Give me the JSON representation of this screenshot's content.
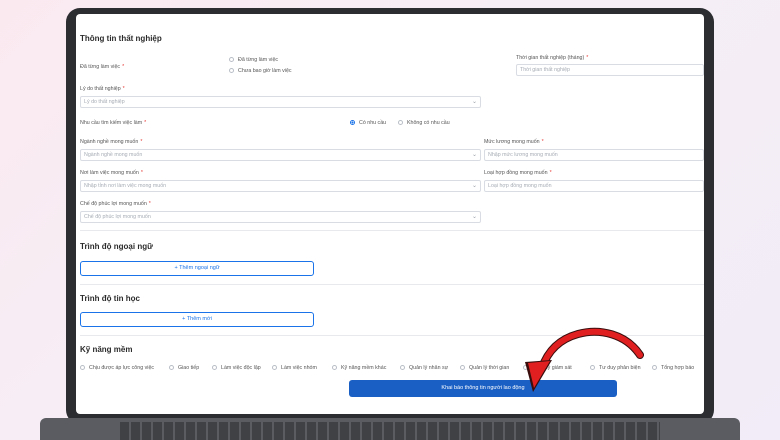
{
  "unemployment": {
    "title": "Thông tin thất nghiệp",
    "worked_label": "Đã từng làm việc",
    "worked_options": [
      "Đã từng làm việc",
      "Chưa bao giờ làm việc"
    ],
    "duration_label": "Thời gian thất nghiệp (tháng)",
    "duration_placeholder": "Thời gian thất nghiệp",
    "reason_label": "Lý do thất nghiệp",
    "reason_placeholder": "Lý do thất nghiệp",
    "job_need_label": "Nhu cầu tìm kiếm việc làm",
    "job_need_options": [
      "Có nhu cầu",
      "Không có nhu cầu"
    ],
    "job_need_selected": "Có nhu cầu",
    "career_label": "Ngành nghề mong muốn",
    "career_placeholder": "Ngành nghề mong muốn",
    "salary_label": "Mức lương mong muốn",
    "salary_placeholder": "Nhập mức lương mong muốn",
    "workplace_label": "Nơi làm việc mong muốn",
    "workplace_placeholder": "Nhập tỉnh nơi làm việc mong muốn",
    "contract_label": "Loại hợp đồng mong muốn",
    "contract_placeholder": "Loại hợp đồng mong muốn",
    "benefits_label": "Chế độ phúc lợi mong muốn",
    "benefits_placeholder": "Chế độ phúc lợi mong muốn"
  },
  "foreign_language": {
    "title": "Trình độ ngoại ngữ",
    "add_label": "Thêm ngoại ngữ"
  },
  "it_skills": {
    "title": "Trình độ tin học",
    "add_label": "Thêm mới"
  },
  "soft_skills": {
    "title": "Kỹ năng mềm",
    "items": [
      "Chịu được áp lực công việc",
      "Giao tiếp",
      "Làm việc độc lập",
      "Làm việc nhóm",
      "Kỹ năng mềm khác",
      "Quản lý nhân sự",
      "Quản lý thời gian",
      "Quản lý giám sát",
      "Tư duy phản biện",
      "Tổng hợp báo"
    ]
  },
  "submit_label": "Khai báo thông tin người lao động",
  "required_mark": "*",
  "icons": {
    "dropdown": "chevron-down-icon",
    "add": "plus-icon",
    "annotation": "red-curved-arrow-icon"
  },
  "colors": {
    "accent": "#1a73e8",
    "submit": "#1a5fc4",
    "required": "#e53935",
    "arrow": "#e02020"
  }
}
